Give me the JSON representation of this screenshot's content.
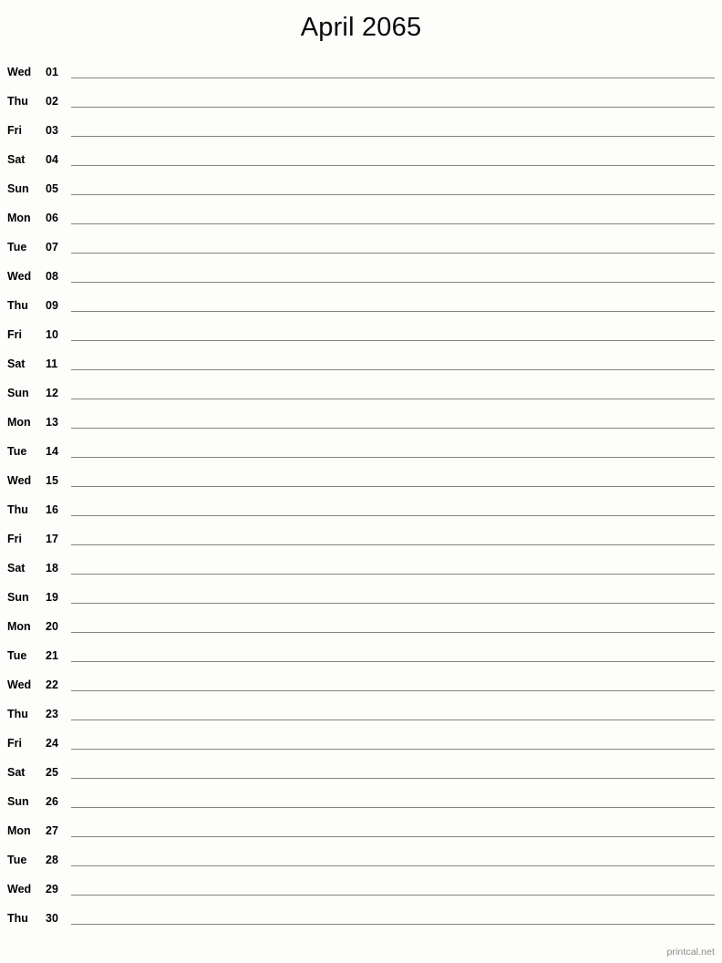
{
  "document": {
    "title": "April 2065",
    "footer": "printcal.net",
    "line_color": "#7f867e",
    "background_color": "#fdfdfb",
    "text_color": "#000000",
    "footer_color": "#8a8a8a"
  },
  "rows": [
    {
      "dow": "Wed",
      "day": "01"
    },
    {
      "dow": "Thu",
      "day": "02"
    },
    {
      "dow": "Fri",
      "day": "03"
    },
    {
      "dow": "Sat",
      "day": "04"
    },
    {
      "dow": "Sun",
      "day": "05"
    },
    {
      "dow": "Mon",
      "day": "06"
    },
    {
      "dow": "Tue",
      "day": "07"
    },
    {
      "dow": "Wed",
      "day": "08"
    },
    {
      "dow": "Thu",
      "day": "09"
    },
    {
      "dow": "Fri",
      "day": "10"
    },
    {
      "dow": "Sat",
      "day": "11"
    },
    {
      "dow": "Sun",
      "day": "12"
    },
    {
      "dow": "Mon",
      "day": "13"
    },
    {
      "dow": "Tue",
      "day": "14"
    },
    {
      "dow": "Wed",
      "day": "15"
    },
    {
      "dow": "Thu",
      "day": "16"
    },
    {
      "dow": "Fri",
      "day": "17"
    },
    {
      "dow": "Sat",
      "day": "18"
    },
    {
      "dow": "Sun",
      "day": "19"
    },
    {
      "dow": "Mon",
      "day": "20"
    },
    {
      "dow": "Tue",
      "day": "21"
    },
    {
      "dow": "Wed",
      "day": "22"
    },
    {
      "dow": "Thu",
      "day": "23"
    },
    {
      "dow": "Fri",
      "day": "24"
    },
    {
      "dow": "Sat",
      "day": "25"
    },
    {
      "dow": "Sun",
      "day": "26"
    },
    {
      "dow": "Mon",
      "day": "27"
    },
    {
      "dow": "Tue",
      "day": "28"
    },
    {
      "dow": "Wed",
      "day": "29"
    },
    {
      "dow": "Thu",
      "day": "30"
    }
  ]
}
